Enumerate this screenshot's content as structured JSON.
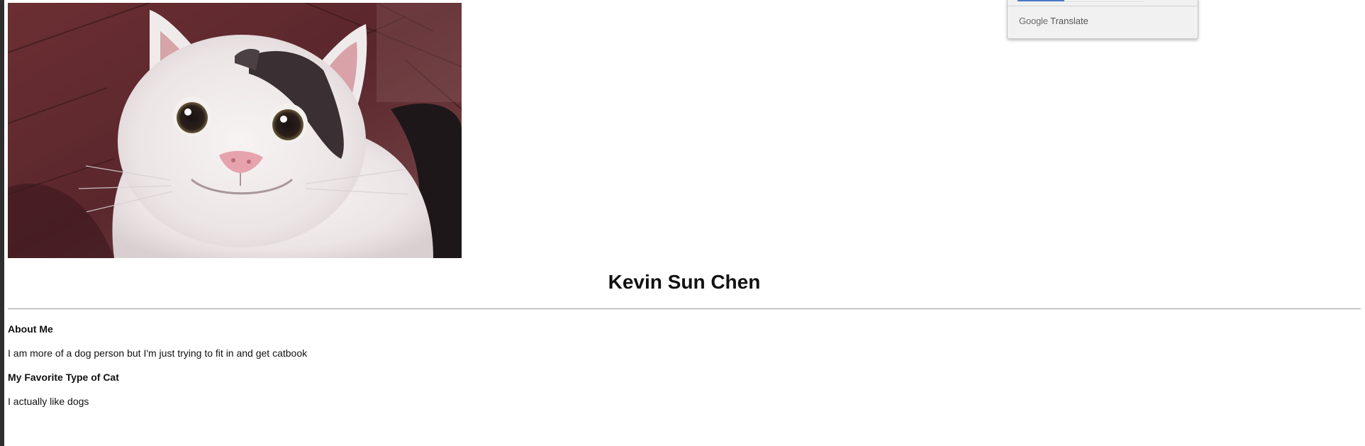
{
  "translate_widget": {
    "brand_google": "Google",
    "brand_translate": "Translate"
  },
  "profile": {
    "photo_alt": "Smiling white and black cat",
    "name": "Kevin Sun Chen"
  },
  "sections": {
    "about_heading": "About Me",
    "about_text": "I am more of a dog person but I'm just trying to fit in and get catbook",
    "favorite_heading": "My Favorite Type of Cat",
    "favorite_text": "I actually like dogs"
  },
  "colors": {
    "floor": "#5e2b2f",
    "cat_fur": "#f3eeee",
    "cat_dark_patch": "#2a2226",
    "nose": "#e6a3ad",
    "accent_select": "#4a78c8"
  }
}
